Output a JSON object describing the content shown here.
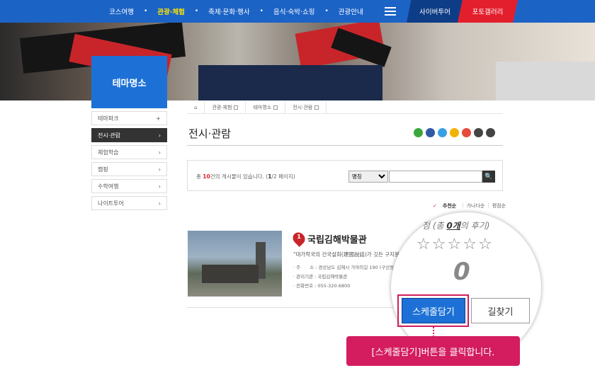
{
  "topnav": {
    "items": [
      "코스여행",
      "관광·체험",
      "축제·문화·행사",
      "음식·숙박·쇼핑",
      "관광안내"
    ],
    "separator": "•",
    "cyber_tour": "사이버투어",
    "photo_gallery": "포토갤러리"
  },
  "sidebar": {
    "title": "테마명소",
    "items": [
      {
        "label": "테마파크",
        "mark": "+"
      },
      {
        "label": "전시·관람",
        "mark": "›"
      },
      {
        "label": "체험학습",
        "mark": "›"
      },
      {
        "label": "캠핑",
        "mark": "›"
      },
      {
        "label": "수학여행",
        "mark": "›"
      },
      {
        "label": "나이트투어",
        "mark": "›"
      }
    ]
  },
  "breadcrumb": {
    "home": "⌂",
    "items": [
      "관광·체험",
      "테마명소",
      "전시·관람"
    ]
  },
  "page": {
    "title": "전시·관람"
  },
  "search": {
    "count_prefix": "총 ",
    "count": "10",
    "count_mid": "건의 게시물이 있습니다. (",
    "page_current": "1",
    "page_rest": "/2 페이지)",
    "select_value": "명칭",
    "button": "🔍"
  },
  "sort": {
    "items": [
      "추천순",
      "가나다순",
      "평점순"
    ],
    "check": "✓"
  },
  "item": {
    "number": "1",
    "title": "국립김해박물관",
    "desc": "\"대가락국의 건국설화(建國說話)가 깃든 구지봉",
    "info": [
      "· 주　　소 : 경상남도 김해시 가야의길 190 (구산동)",
      "· 관리기관 : 국립김해박물관",
      "· 전화번호 : 055-320-6800"
    ]
  },
  "zoom": {
    "rating_label_pre": "점 (총 ",
    "rating_count": "0개",
    "rating_label_post": "의 후기)",
    "stars": [
      "☆",
      "☆",
      "☆",
      "☆",
      "☆"
    ],
    "score": "0",
    "schedule_button": "스케줄담기",
    "directions_button": "길찾기"
  },
  "callout": {
    "text": "[스케줄담기]버튼을 클릭합니다."
  },
  "colors": {
    "primary": "#1d71d6",
    "nav": "#1c63c6",
    "accent": "#d31d5e",
    "red": "#e41f2d"
  }
}
